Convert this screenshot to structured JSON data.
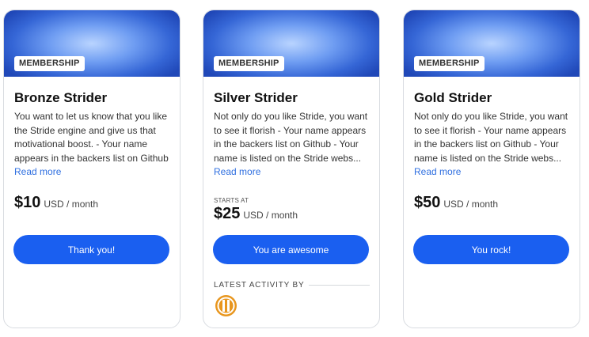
{
  "tiers": [
    {
      "badge": "MEMBERSHIP",
      "title": "Bronze Strider",
      "description": "You want to let us know that you like the Stride engine and give us that motivational boost. - Your name appears in the backers list on Github",
      "read_more": "Read more",
      "amount": "$10",
      "period": "USD / month",
      "button": "Thank you!"
    },
    {
      "badge": "MEMBERSHIP",
      "title": "Silver Strider",
      "description": "Not only do you like Stride, you want to see it florish - Your name appears in the backers list on Github - Your name is listed on the Stride webs...",
      "read_more": "Read more",
      "starts_at": "STARTS AT",
      "amount": "$25",
      "period": "USD / month",
      "button": "You are awesome",
      "activity_label": "LATEST ACTIVITY BY"
    },
    {
      "badge": "MEMBERSHIP",
      "title": "Gold Strider",
      "description": "Not only do you like Stride, you want to see it florish - Your name appears in the backers list on Github - Your name is listed on the Stride webs...",
      "read_more": "Read more",
      "amount": "$50",
      "period": "USD / month",
      "button": "You rock!"
    }
  ],
  "colors": {
    "accent": "#1a5ff0",
    "link": "#2f6fe0",
    "avatar_orange": "#e8961e"
  }
}
